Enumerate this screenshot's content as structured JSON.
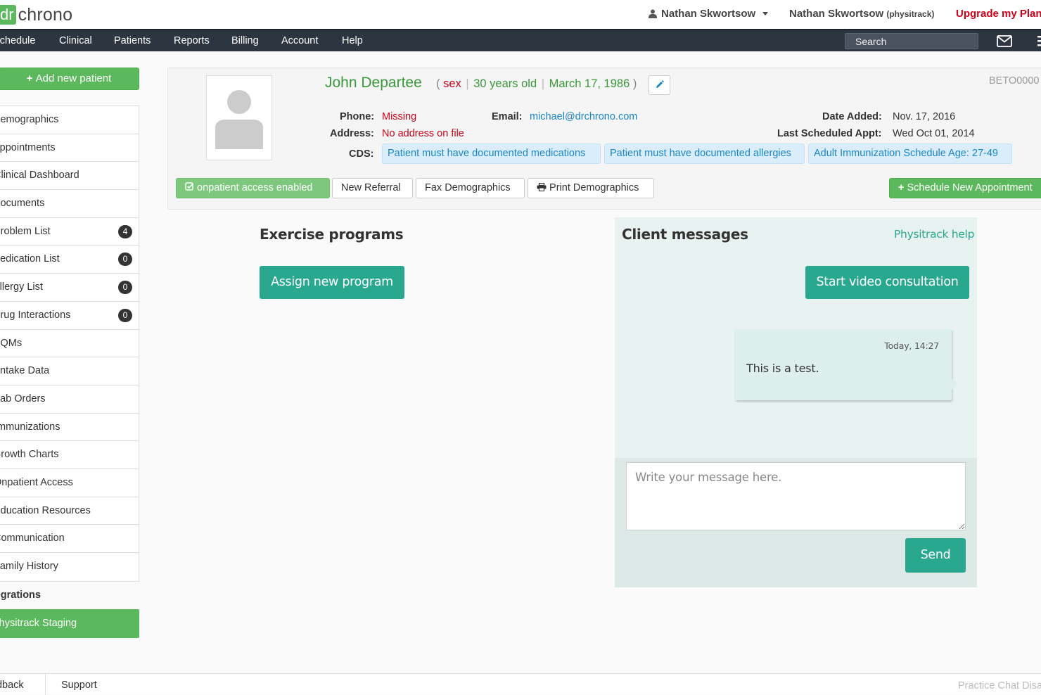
{
  "brand": {
    "logo_dr": "dr",
    "logo_chrono": "chrono",
    "accent": "#5cb85c",
    "teal": "#2aa78f"
  },
  "topbar": {
    "user_menu": "Nathan Skwortsow",
    "user_name": "Nathan Skwortsow",
    "user_org": "(physitrack)",
    "upgrade": "Upgrade my Plan"
  },
  "nav": {
    "items": [
      "Schedule",
      "Clinical",
      "Patients",
      "Reports",
      "Billing",
      "Account",
      "Help"
    ],
    "search_placeholder": "Search"
  },
  "sidebar": {
    "add_patient": "Add new patient",
    "items": [
      {
        "label": "Demographics"
      },
      {
        "label": "Appointments"
      },
      {
        "label": "Clinical Dashboard"
      },
      {
        "label": "Documents"
      },
      {
        "label": "Problem List",
        "badge": "4"
      },
      {
        "label": "Medication List",
        "badge": "0"
      },
      {
        "label": "Allergy List",
        "badge": "0"
      },
      {
        "label": "Drug Interactions",
        "badge": "0"
      },
      {
        "label": "CQMs"
      },
      {
        "label": "Intake Data"
      },
      {
        "label": "Lab Orders"
      },
      {
        "label": "Immunizations"
      },
      {
        "label": "Growth Charts"
      },
      {
        "label": "Onpatient Access"
      },
      {
        "label": "Education Resources"
      },
      {
        "label": "Communication"
      },
      {
        "label": "Family History"
      }
    ],
    "integrations_heading": "Integrations",
    "integration_active": "Physitrack Staging"
  },
  "patient": {
    "name": "John Departee",
    "sex": "sex",
    "age": "30 years old",
    "dob": "March 17, 1986",
    "id": "BETO0000",
    "phone_label": "Phone:",
    "phone_value": "Missing",
    "address_label": "Address:",
    "address_value": "No address on file",
    "email_label": "Email:",
    "email_value": "michael@drchrono.com",
    "date_added_label": "Date Added:",
    "date_added_value": "Nov. 17, 2016",
    "last_appt_label": "Last Scheduled Appt:",
    "last_appt_value": "Wed Oct 01, 2014",
    "cds_label": "CDS:",
    "cds_tags": [
      "Patient must have documented medications",
      "Patient must have documented allergies",
      "Adult Immunization Schedule Age: 27-49"
    ],
    "buttons": {
      "access": "onpatient access enabled",
      "referral": "New Referral",
      "fax": "Fax Demographics",
      "print": "Print Demographics",
      "schedule": "Schedule New Appointment"
    }
  },
  "exercise": {
    "title": "Exercise programs",
    "assign": "Assign new program"
  },
  "messages": {
    "title": "Client messages",
    "help": "Physitrack help",
    "video": "Start video consultation",
    "items": [
      {
        "time": "Today, 14:27",
        "text": "This is a test."
      }
    ],
    "input_placeholder": "Write your message here.",
    "send": "Send"
  },
  "footer": {
    "feedback": "Feedback",
    "support": "Support",
    "chat": "Practice Chat Disabled"
  }
}
